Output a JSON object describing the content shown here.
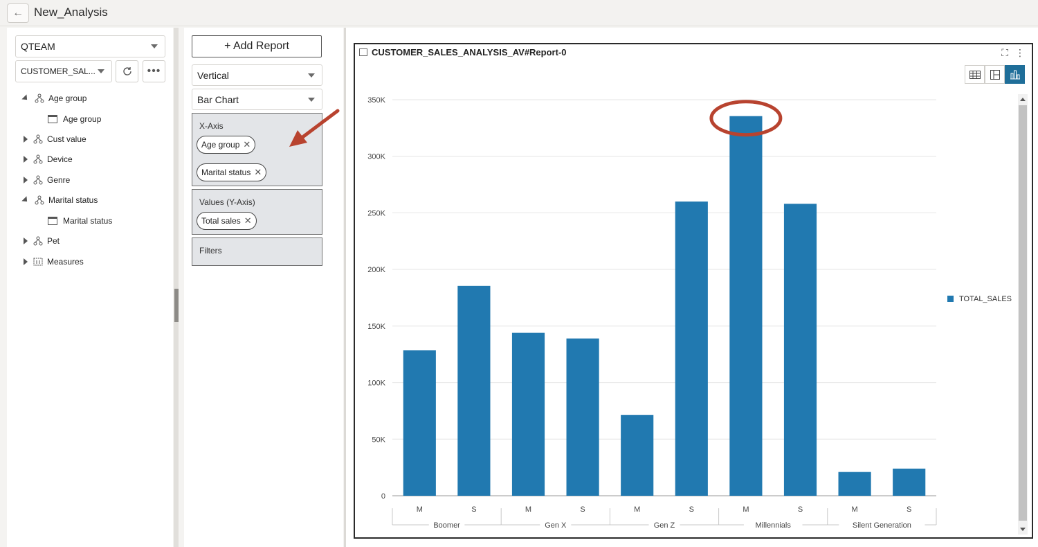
{
  "header": {
    "back_icon": "arrow-left-icon",
    "title": "New_Analysis"
  },
  "left_panel": {
    "schema_select": "QTEAM",
    "view_select": "CUSTOMER_SAL...",
    "refresh_icon": "refresh-icon",
    "more_icon": "more-dots-icon",
    "tree": [
      {
        "label": "Age group",
        "expanded": true,
        "icon": "hierarchy-icon",
        "children": [
          "Age group"
        ]
      },
      {
        "label": "Cust value",
        "expanded": false,
        "icon": "hierarchy-icon"
      },
      {
        "label": "Device",
        "expanded": false,
        "icon": "hierarchy-icon"
      },
      {
        "label": "Genre",
        "expanded": false,
        "icon": "hierarchy-icon"
      },
      {
        "label": "Marital status",
        "expanded": true,
        "icon": "hierarchy-icon",
        "children": [
          "Marital status"
        ]
      },
      {
        "label": "Pet",
        "expanded": false,
        "icon": "hierarchy-icon"
      },
      {
        "label": "Measures",
        "expanded": false,
        "icon": "measures-icon"
      }
    ]
  },
  "mid_panel": {
    "add_report_label": "+ Add Report",
    "orientation_select": "Vertical",
    "chart_type_select": "Bar Chart",
    "x_axis": {
      "label": "X-Axis",
      "chips": [
        "Age group",
        "Marital status"
      ]
    },
    "values": {
      "label": "Values (Y-Axis)",
      "chips": [
        "Total sales"
      ]
    },
    "filters": {
      "label": "Filters"
    },
    "chip_remove_icon": "close-icon"
  },
  "report": {
    "title": "CUSTOMER_SALES_ANALYSIS_AV#Report-0",
    "expand_icon": "fullscreen-icon",
    "menu_icon": "kebab-menu-icon",
    "view_buttons": [
      "table-view-icon",
      "split-view-icon",
      "chart-view-icon"
    ],
    "active_view": "chart-view-icon"
  },
  "colors": {
    "bar": "#2179b0",
    "accent": "#1f6e99",
    "annotation": "#b8432f"
  },
  "chart_data": {
    "type": "bar",
    "groups": [
      "Boomer",
      "Gen X",
      "Gen Z",
      "Millennials",
      "Silent Generation"
    ],
    "categories": [
      "M",
      "S",
      "M",
      "S",
      "M",
      "S",
      "M",
      "S",
      "M",
      "S"
    ],
    "series": [
      {
        "name": "TOTAL_SALES",
        "values": [
          128500,
          185500,
          144000,
          139000,
          71500,
          260000,
          335500,
          258000,
          21000,
          24000
        ]
      }
    ],
    "ylim": [
      0,
      350000
    ],
    "yticks": [
      "0",
      "50K",
      "100K",
      "150K",
      "200K",
      "250K",
      "300K",
      "350K"
    ],
    "grid": true,
    "legend": "right"
  }
}
